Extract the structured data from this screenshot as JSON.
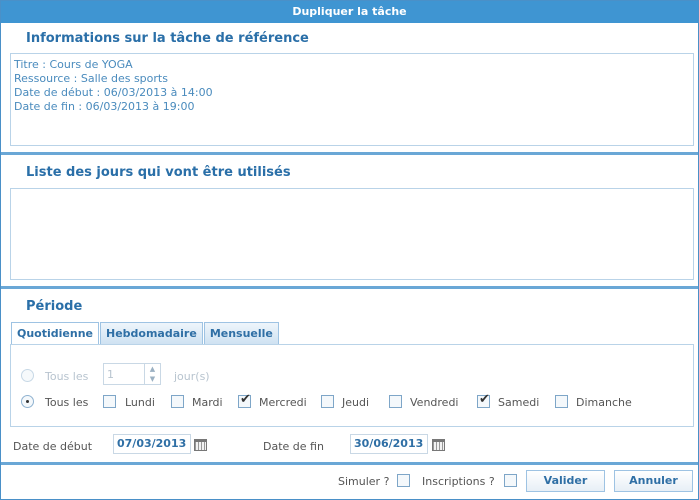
{
  "dialog": {
    "title": "Dupliquer la tâche"
  },
  "reference": {
    "title": "Informations sur la tâche de référence",
    "lines": [
      "Titre : Cours de YOGA",
      "Ressource : Salle des sports",
      "Date de début : 06/03/2013 à 14:00",
      "Date de fin : 06/03/2013 à 19:00"
    ]
  },
  "days_list": {
    "title": "Liste des jours qui vont être utilisés"
  },
  "period": {
    "title": "Période",
    "tabs": [
      "Quotidienne",
      "Hebdomadaire",
      "Mensuelle"
    ],
    "active_tab": "Quotidienne",
    "every_n": {
      "label": "Tous les",
      "value": "1",
      "unit": "jour(s)",
      "checked": false,
      "enabled": false
    },
    "every_days": {
      "label": "Tous les",
      "checked": true,
      "days": [
        {
          "label": "Lundi",
          "checked": false
        },
        {
          "label": "Mardi",
          "checked": false
        },
        {
          "label": "Mercredi",
          "checked": true
        },
        {
          "label": "Jeudi",
          "checked": false
        },
        {
          "label": "Vendredi",
          "checked": false
        },
        {
          "label": "Samedi",
          "checked": true
        },
        {
          "label": "Dimanche",
          "checked": false
        }
      ]
    }
  },
  "dates": {
    "start_label": "Date de début",
    "start_value": "07/03/2013",
    "end_label": "Date de fin",
    "end_value": "30/06/2013"
  },
  "footer": {
    "simulate_label": "Simuler ?",
    "simulate_checked": false,
    "inscriptions_label": "Inscriptions ?",
    "inscriptions_checked": false,
    "validate_label": "Valider",
    "cancel_label": "Annuler"
  },
  "colors": {
    "title_bar": "#3f95d2",
    "accent_text": "#2a6fa8",
    "separator": "#6aa7d6"
  }
}
